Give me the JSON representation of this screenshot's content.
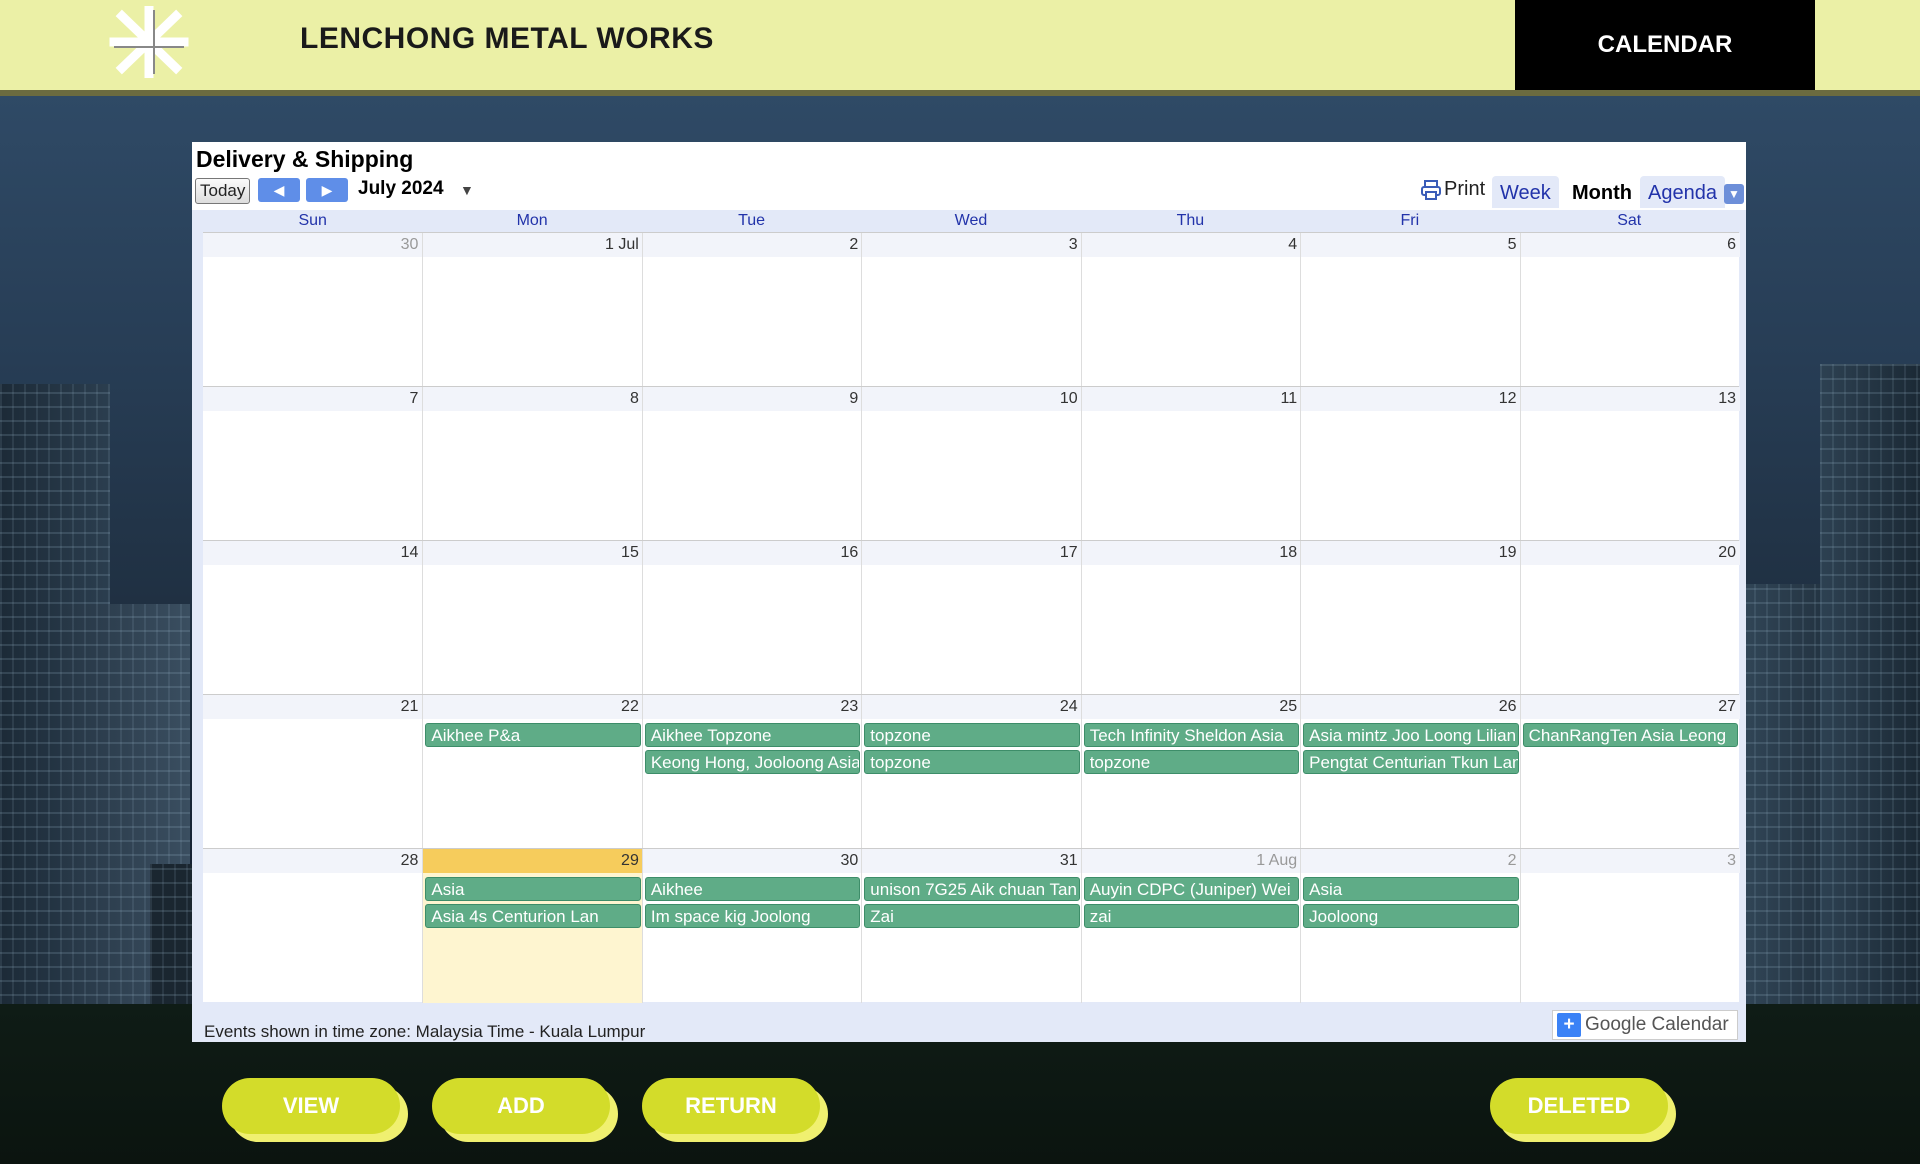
{
  "header": {
    "brand": "LENCHONG METAL WORKS",
    "nav_tab": "CALENDAR"
  },
  "calendar": {
    "title": "Delivery & Shipping",
    "today_label": "Today",
    "month_label": "July 2024",
    "print_label": "Print",
    "views": [
      "Week",
      "Month",
      "Agenda"
    ],
    "active_view": "Month",
    "weekdays": [
      "Sun",
      "Mon",
      "Tue",
      "Wed",
      "Thu",
      "Fri",
      "Sat"
    ],
    "weeks": [
      [
        {
          "label": "30",
          "other": true
        },
        {
          "label": "1 Jul"
        },
        {
          "label": "2"
        },
        {
          "label": "3"
        },
        {
          "label": "4"
        },
        {
          "label": "5"
        },
        {
          "label": "6"
        }
      ],
      [
        {
          "label": "7"
        },
        {
          "label": "8"
        },
        {
          "label": "9"
        },
        {
          "label": "10"
        },
        {
          "label": "11"
        },
        {
          "label": "12"
        },
        {
          "label": "13"
        }
      ],
      [
        {
          "label": "14"
        },
        {
          "label": "15"
        },
        {
          "label": "16"
        },
        {
          "label": "17"
        },
        {
          "label": "18"
        },
        {
          "label": "19"
        },
        {
          "label": "20"
        }
      ],
      [
        {
          "label": "21"
        },
        {
          "label": "22",
          "events": [
            "Aikhee P&a"
          ]
        },
        {
          "label": "23",
          "events": [
            "Aikhee Topzone",
            "Keong Hong, Jooloong Asia"
          ]
        },
        {
          "label": "24",
          "events": [
            "topzone",
            "topzone"
          ]
        },
        {
          "label": "25",
          "events": [
            "Tech Infinity Sheldon Asia",
            "topzone"
          ]
        },
        {
          "label": "26",
          "events": [
            "Asia mintz Joo Loong Lilian",
            "Pengtat Centurian Tkun Lan"
          ]
        },
        {
          "label": "27",
          "events": [
            "ChanRangTen Asia Leong"
          ]
        }
      ],
      [
        {
          "label": "28"
        },
        {
          "label": "29",
          "today": true,
          "events": [
            "Asia",
            "Asia 4s Centurion Lan"
          ]
        },
        {
          "label": "30",
          "events": [
            "Aikhee",
            "Im space kig Joolong"
          ]
        },
        {
          "label": "31",
          "events": [
            "unison 7G25 Aik chuan Tan",
            "Zai"
          ]
        },
        {
          "label": "1 Aug",
          "other": true,
          "events": [
            "Auyin CDPC (Juniper) Wei",
            "zai"
          ]
        },
        {
          "label": "2",
          "other": true,
          "events": [
            "Asia",
            "Jooloong"
          ]
        },
        {
          "label": "3",
          "other": true
        }
      ]
    ],
    "timezone_note": "Events shown in time zone: Malaysia Time - Kuala Lumpur",
    "google_calendar_badge": "Google Calendar",
    "event_color": "#5fac87",
    "today_color": "#f6cc5c"
  },
  "actions": {
    "view": "VIEW",
    "add": "ADD",
    "return": "RETURN",
    "deleted": "DELETED"
  }
}
